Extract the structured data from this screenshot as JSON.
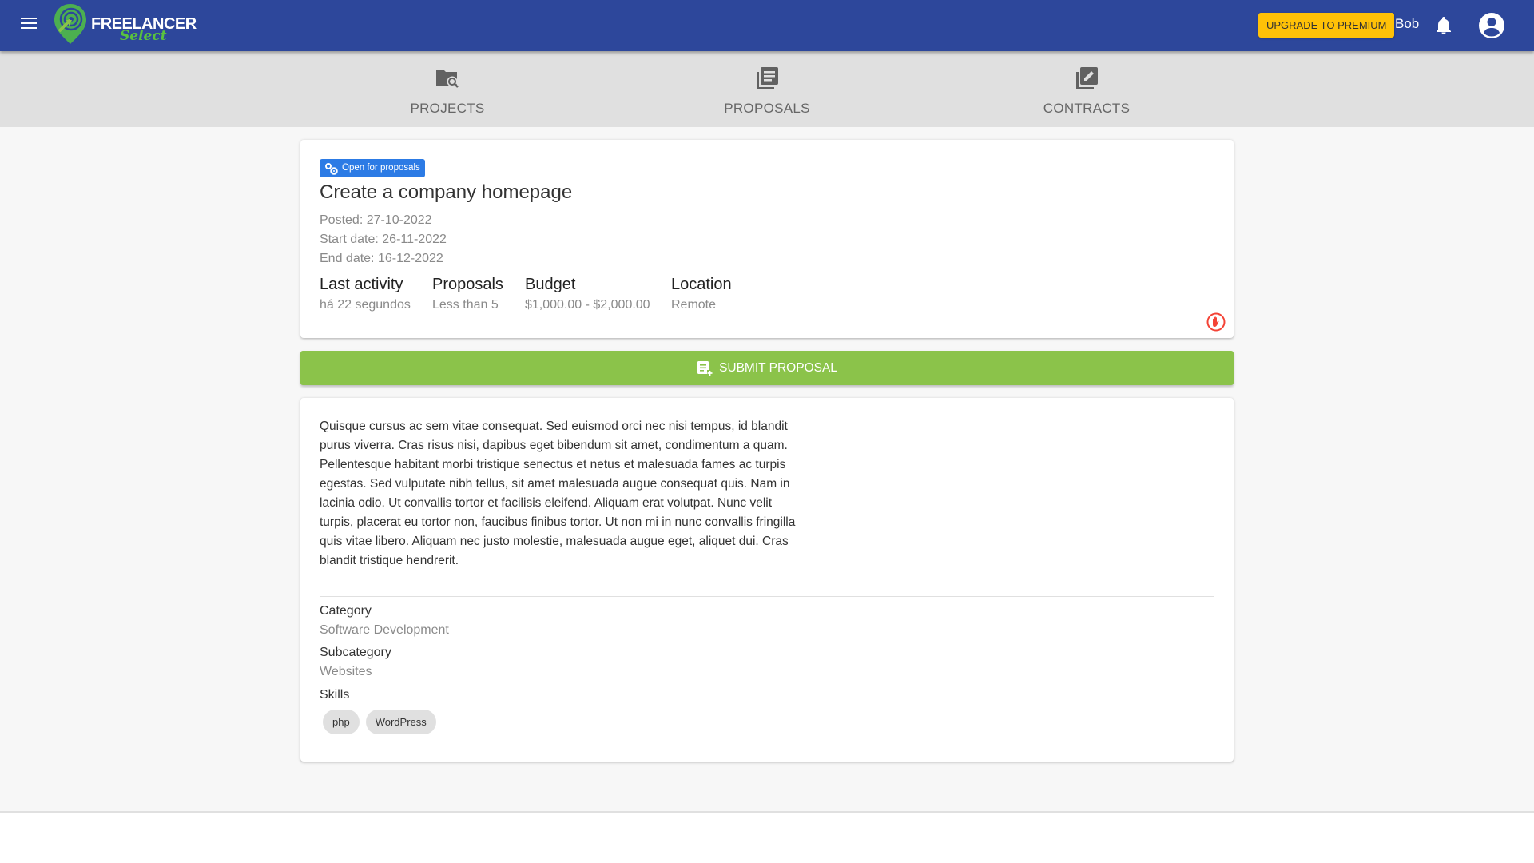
{
  "header": {
    "logo_primary": "FREELANCER",
    "logo_secondary": "Select",
    "upgrade_label": "UPGRADE TO PREMIUM",
    "user_name": "Bob",
    "icons": [
      "menu-icon",
      "bell-icon",
      "account-circle-icon"
    ]
  },
  "nav": {
    "items": [
      {
        "label": "PROJECTS",
        "icon": "folder-search-icon"
      },
      {
        "label": "PROPOSALS",
        "icon": "library-books-icon"
      },
      {
        "label": "CONTRACTS",
        "icon": "edit-note-icon"
      }
    ]
  },
  "project": {
    "status_badge": "Open for proposals",
    "title": "Create a company homepage",
    "posted": "Posted: 27-10-2022",
    "start_date": "Start date: 26-11-2022",
    "end_date": "End date: 16-12-2022",
    "stats": [
      {
        "label": "Last activity",
        "value": "há 22 segundos"
      },
      {
        "label": "Proposals",
        "value": "Less than 5"
      },
      {
        "label": "Budget",
        "value": "$1,000.00 - $2,000.00"
      },
      {
        "label": "Location",
        "value": "Remote"
      }
    ],
    "submit_label": "SUBMIT PROPOSAL",
    "description": "Quisque cursus ac sem vitae consequat. Sed euismod orci nec nisi tempus, id blandit purus viverra. Cras risus nisi, dapibus eget bibendum sit amet, condimentum a quam. Pellentesque habitant morbi tristique senectus et netus et malesuada fames ac turpis egestas. Sed vulputate nibh tellus, sit amet malesuada augue consequat quis. Nam in lacinia odio. Ut convallis tortor et facilisis eleifend. Aliquam erat volutpat. Nunc velit turpis, placerat eu tortor non, faucibus finibus tortor. Ut non mi in nunc convallis fringilla quis vitae libero. Aliquam nec justo molestie, malesuada augue eget, aliquet dui. Cras blandit tristique hendrerit.",
    "category_label": "Category",
    "category": "Software Development",
    "subcategory_label": "Subcategory",
    "subcategory": "Websites",
    "skills_label": "Skills",
    "skills": [
      "php",
      "WordPress"
    ]
  },
  "colors": {
    "header_bg": "#2d479b",
    "upgrade_bg": "#ffc107",
    "badge_bg": "#2c7be5",
    "submit_bg": "#8bc34a",
    "stop_icon": "#f44336"
  }
}
